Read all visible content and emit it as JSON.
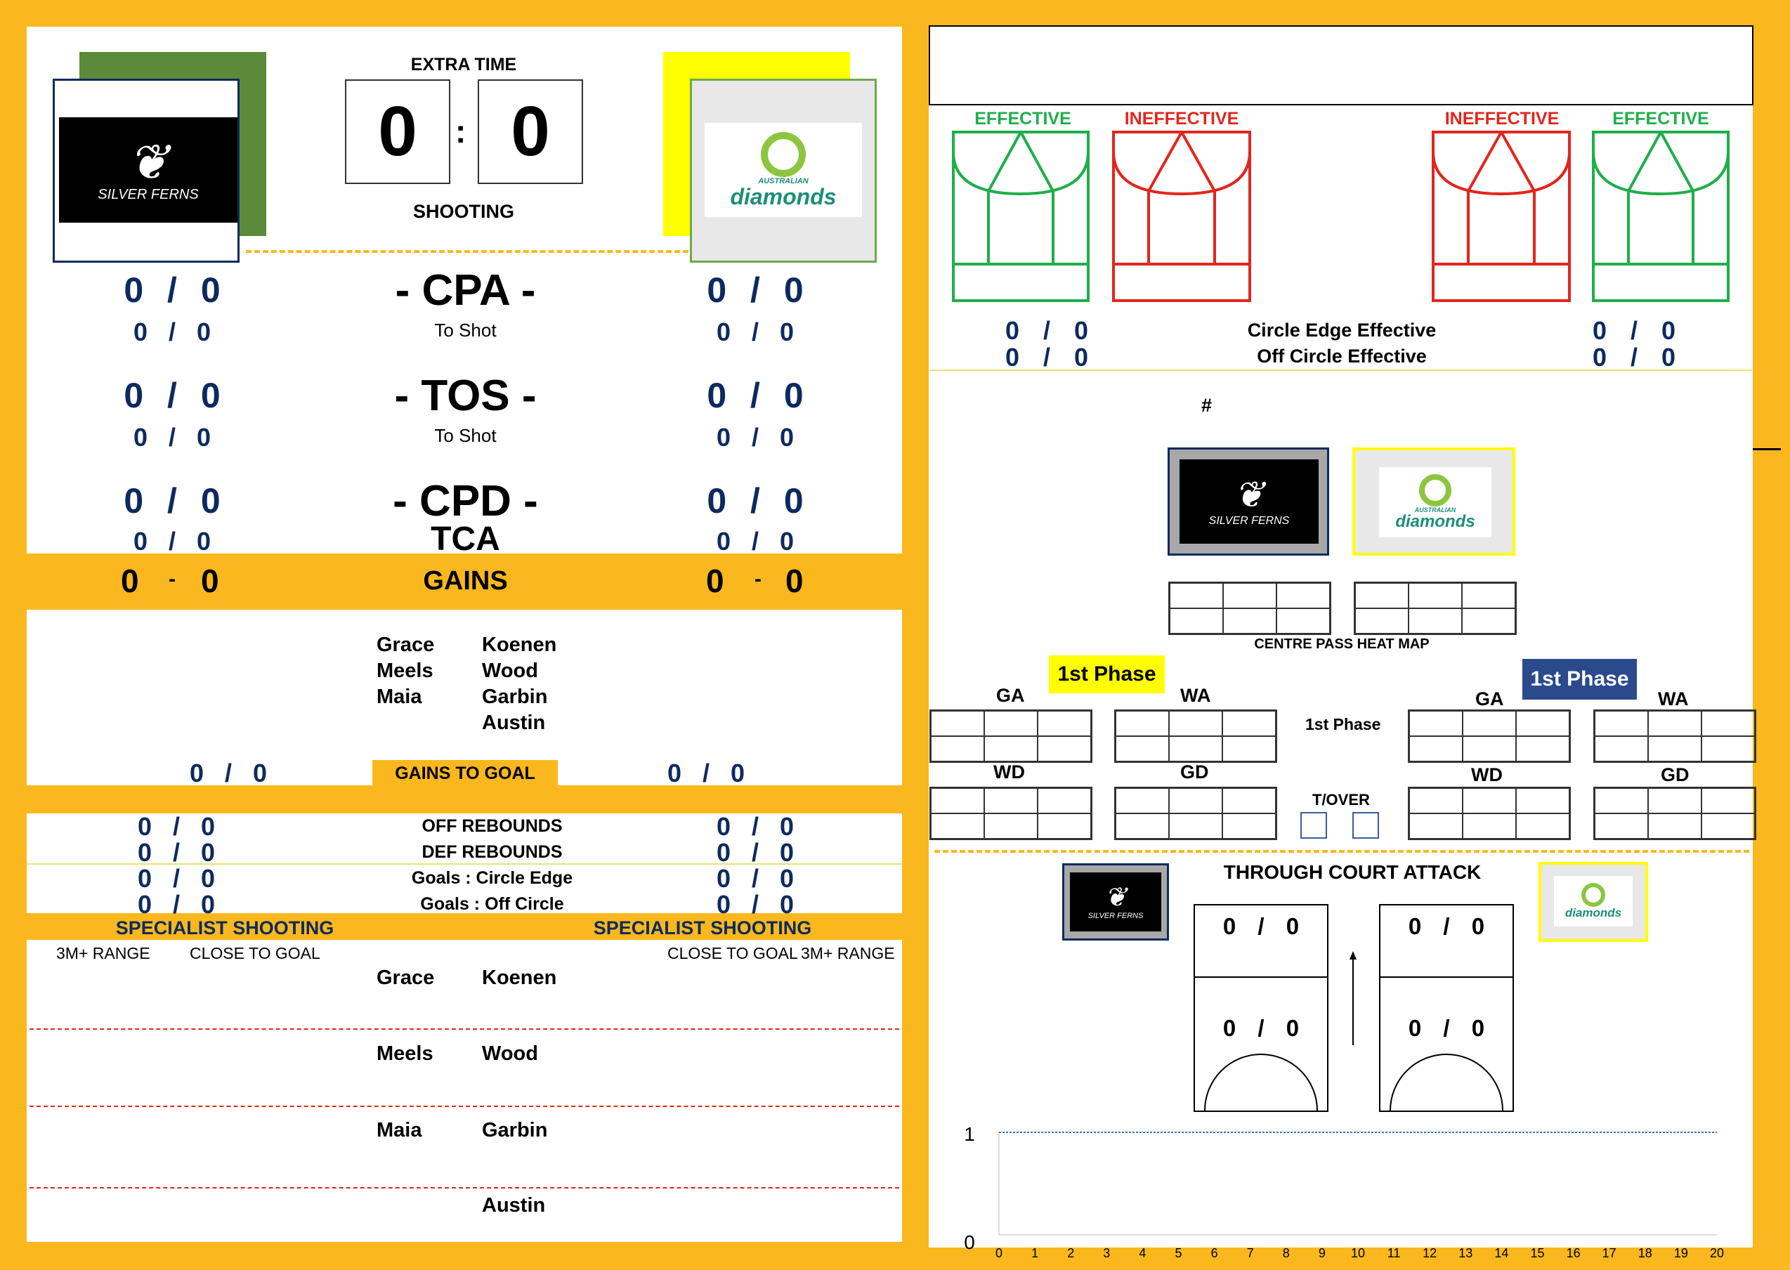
{
  "header": {
    "extra_time": "EXTRA TIME",
    "shooting": "SHOOTING",
    "score_home": "0",
    "score_sep": ":",
    "score_away": "0"
  },
  "teams": {
    "home_logo_text": "SILVER FERNS",
    "away_logo_top": "AUSTRALIAN",
    "away_logo_main": "diamonds"
  },
  "stats": {
    "cpa": "- CPA -",
    "tos": "- TOS -",
    "cpd": "- CPD -",
    "to_shot": "To Shot",
    "tca": "TCA",
    "gains": "GAINS",
    "left_cpa": "0 / 0",
    "left_cpa_shot": "0 / 0",
    "right_cpa": "0 / 0",
    "right_cpa_shot": "0 / 0",
    "left_tos": "0 / 0",
    "left_tos_shot": "0 / 0",
    "right_tos": "0 / 0",
    "right_tos_shot": "0 / 0",
    "left_cpd": "0 / 0",
    "left_tca": "0 / 0",
    "right_cpd": "0 / 0",
    "right_tca": "0 / 0",
    "left_gains_a": "0",
    "left_gains_b": "0",
    "right_gains_a": "0",
    "right_gains_b": "0",
    "gains_dash": "-"
  },
  "players": {
    "home": [
      "Grace",
      "Meels",
      "Maia"
    ],
    "away": [
      "Koenen",
      "Wood",
      "Garbin",
      "Austin"
    ]
  },
  "gains_to_goal": {
    "label": "GAINS TO GOAL",
    "left": "0 / 0",
    "right": "0 / 0"
  },
  "rebounds": [
    {
      "label": "OFF REBOUNDS",
      "left": "0 / 0",
      "right": "0 / 0"
    },
    {
      "label": "DEF REBOUNDS",
      "left": "0 / 0",
      "right": "0 / 0"
    },
    {
      "label": "Goals : Circle Edge",
      "left": "0 / 0",
      "right": "0 / 0"
    },
    {
      "label": "Goals : Off Circle",
      "left": "0 / 0",
      "right": "0 / 0"
    }
  ],
  "specialist": {
    "title": "SPECIALIST SHOOTING",
    "range3m": "3M+ RANGE",
    "close": "CLOSE TO GOAL",
    "rows": [
      {
        "home": "Grace",
        "away": "Koenen"
      },
      {
        "home": "Meels",
        "away": "Wood"
      },
      {
        "home": "Maia",
        "away": "Garbin"
      },
      {
        "home": "",
        "away": "Austin"
      }
    ]
  },
  "circle": {
    "effective": "EFFECTIVE",
    "ineffective": "INEFFECTIVE",
    "edge_label": "Circle Edge Effective",
    "off_label": "Off Circle Effective",
    "left_edge": "0 / 0",
    "left_off": "0 / 0",
    "right_edge": "0 / 0",
    "right_off": "0 / 0"
  },
  "centre_pass": {
    "hash": "#",
    "heatmap": "CENTRE PASS HEAT MAP",
    "first_phase": "1st Phase",
    "mid_phase": "1st Phase",
    "tover": "T/OVER",
    "ga": "GA",
    "wa": "WA",
    "wd": "WD",
    "gd": "GD"
  },
  "tca": {
    "title": "THROUGH COURT ATTACK",
    "l_top": "0 / 0",
    "l_bot": "0 / 0",
    "r_top": "0 / 0",
    "r_bot": "0 / 0"
  },
  "chart_data": {
    "type": "line",
    "x": [
      0,
      1,
      2,
      3,
      4,
      5,
      6,
      7,
      8,
      9,
      10,
      11,
      12,
      13,
      14,
      15,
      16,
      17,
      18,
      19,
      20
    ],
    "ylim": [
      0,
      1
    ],
    "yticks": [
      "1",
      "0"
    ],
    "series": [
      {
        "values": [
          1,
          1,
          1,
          1,
          1,
          1,
          1,
          1,
          1,
          1,
          1,
          1,
          1,
          1,
          1,
          1,
          1,
          1,
          1,
          1,
          1
        ]
      }
    ]
  },
  "colors": {
    "gold": "#fbb81e",
    "navy": "#0d2a5e",
    "green": "#1fae4b",
    "red": "#e2261d"
  }
}
